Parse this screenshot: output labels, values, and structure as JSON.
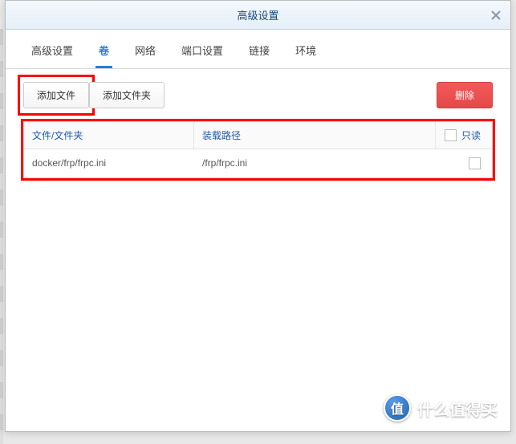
{
  "dialog": {
    "title": "高级设置"
  },
  "tabs": [
    {
      "label": "高级设置",
      "active": false
    },
    {
      "label": "卷",
      "active": true
    },
    {
      "label": "网络",
      "active": false
    },
    {
      "label": "端口设置",
      "active": false
    },
    {
      "label": "链接",
      "active": false
    },
    {
      "label": "环境",
      "active": false
    }
  ],
  "toolbar": {
    "add_file": "添加文件",
    "add_folder": "添加文件夹",
    "delete": "删除"
  },
  "table": {
    "headers": {
      "path": "文件/文件夹",
      "mount": "装载路径",
      "readonly": "只读"
    },
    "rows": [
      {
        "path": "docker/frp/frpc.ini",
        "mount": "/frp/frpc.ini",
        "readonly": false
      }
    ]
  },
  "brand": {
    "badge": "值",
    "text": "什么值得买"
  }
}
